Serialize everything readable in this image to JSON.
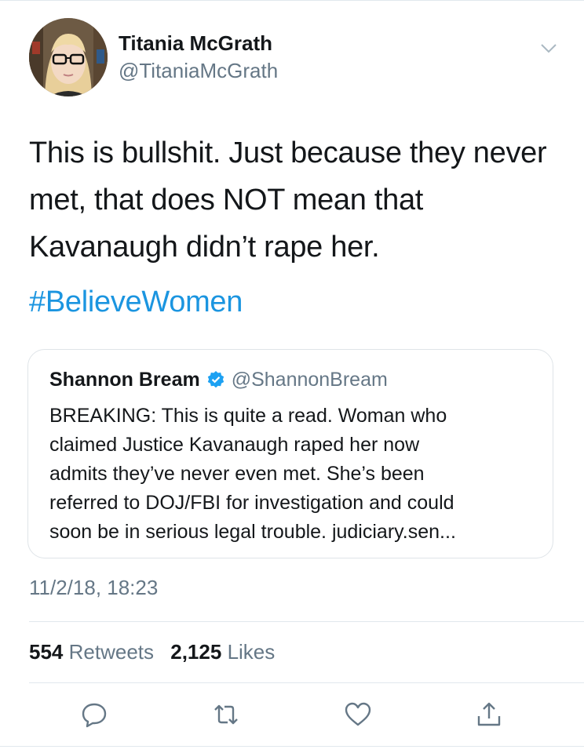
{
  "author": {
    "name": "Titania McGrath",
    "handle": "@TitaniaMcGrath"
  },
  "tweet": {
    "text": "This is bullshit. Just because they never\nmet, that does NOT mean that\nKavanaugh didn’t rape her.",
    "hashtag": "#BelieveWomen",
    "timestamp": "11/2/18, 18:23"
  },
  "quoted_tweet": {
    "name": "Shannon Bream",
    "handle": "@ShannonBream",
    "text": "BREAKING:  This is quite a read. Woman who\nclaimed Justice Kavanaugh raped her now\nadmits they’ve never even met. She’s been\nreferred to DOJ/FBI for investigation and could\nsoon be in serious legal trouble.  judiciary.sen..."
  },
  "stats": {
    "retweets_count": "554",
    "retweets_label": "Retweets",
    "likes_count": "2,125",
    "likes_label": "Likes"
  },
  "icons": {
    "reply": "reply-icon",
    "retweet": "retweet-icon",
    "like": "heart-icon",
    "share": "share-icon",
    "caret": "chevron-down-icon",
    "verified": "verified-badge-icon"
  },
  "colors": {
    "link": "#1b95e0",
    "secondary_text": "#657786",
    "verified": "#1da1f2",
    "divider": "#e1e8ed"
  }
}
